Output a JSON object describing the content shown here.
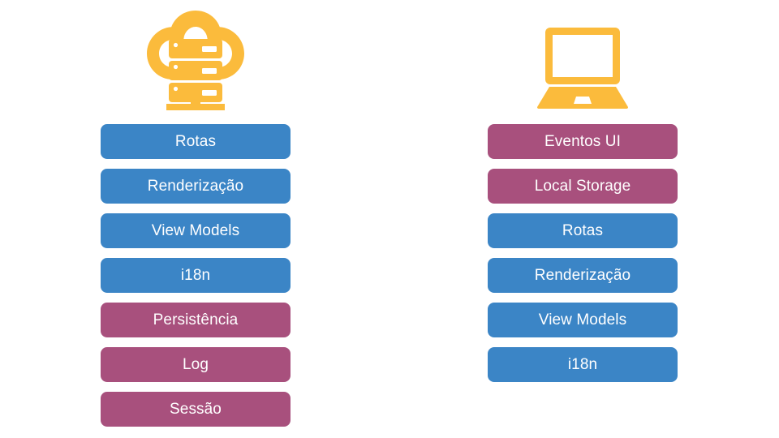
{
  "diagram": {
    "type": "two-column-layer-stack",
    "background_color": "#ffffff",
    "colors": {
      "blue": "#3b85c6",
      "magenta": "#a8507d",
      "amber": "#fbbb3c",
      "text": "#ffffff"
    },
    "columns": [
      {
        "id": "server",
        "icon": "cloud-server-icon",
        "icon_color": "#fbbb3c",
        "items": [
          {
            "label": "Rotas",
            "color": "blue"
          },
          {
            "label": "Renderização",
            "color": "blue"
          },
          {
            "label": "View Models",
            "color": "blue"
          },
          {
            "label": "i18n",
            "color": "blue"
          },
          {
            "label": "Persistência",
            "color": "magenta"
          },
          {
            "label": "Log",
            "color": "magenta"
          },
          {
            "label": "Sessão",
            "color": "magenta"
          }
        ]
      },
      {
        "id": "client",
        "icon": "laptop-icon",
        "icon_color": "#fbbb3c",
        "items": [
          {
            "label": "Eventos UI",
            "color": "magenta"
          },
          {
            "label": "Local Storage",
            "color": "magenta"
          },
          {
            "label": "Rotas",
            "color": "blue"
          },
          {
            "label": "Renderização",
            "color": "blue"
          },
          {
            "label": "View Models",
            "color": "blue"
          },
          {
            "label": "i18n",
            "color": "blue"
          }
        ]
      }
    ]
  }
}
